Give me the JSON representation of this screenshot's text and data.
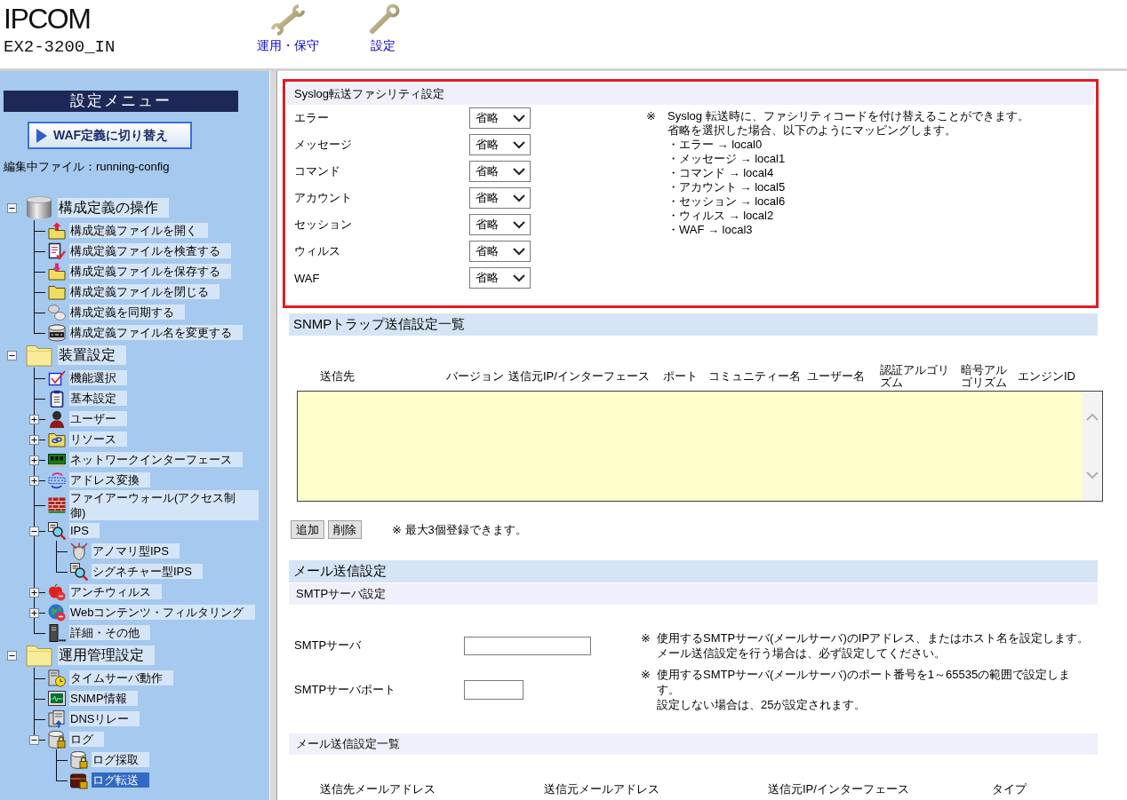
{
  "header": {
    "product": "IPCOM",
    "model": "EX2-3200_IN",
    "nav": [
      "運用・保守",
      "設定"
    ]
  },
  "sidebar": {
    "title": "設定メニュー",
    "switch_button": "WAF定義に切り替え",
    "editing_file": "編集中ファイル：running-config",
    "tree": [
      {
        "label": "構成定義の操作",
        "expanded": true,
        "selected": false,
        "children": [
          {
            "label": "構成定義ファイルを開く",
            "selected": false
          },
          {
            "label": "構成定義ファイルを検査する",
            "selected": false
          },
          {
            "label": "構成定義ファイルを保存する",
            "selected": false
          },
          {
            "label": "構成定義ファイルを閉じる",
            "selected": false
          },
          {
            "label": "構成定義を同期する",
            "selected": false
          },
          {
            "label": "構成定義ファイル名を変更する",
            "selected": false
          }
        ]
      },
      {
        "label": "装置設定",
        "expanded": true,
        "selected": false,
        "children": [
          {
            "label": "機能選択",
            "selected": false
          },
          {
            "label": "基本設定",
            "selected": false
          },
          {
            "label": "ユーザー",
            "expanded": false,
            "selected": false
          },
          {
            "label": "リソース",
            "expanded": false,
            "selected": false
          },
          {
            "label": "ネットワークインターフェース",
            "expanded": false,
            "selected": false
          },
          {
            "label": "アドレス変換",
            "expanded": false,
            "selected": false
          },
          {
            "label": "ファイアーウォール(アクセス制御)",
            "selected": false
          },
          {
            "label": "IPS",
            "expanded": true,
            "selected": false,
            "children": [
              {
                "label": "アノマリ型IPS",
                "selected": false
              },
              {
                "label": "シグネチャー型IPS",
                "selected": false
              }
            ]
          },
          {
            "label": "アンチウィルス",
            "expanded": false,
            "selected": false
          },
          {
            "label": "Webコンテンツ・フィルタリング",
            "expanded": false,
            "selected": false
          },
          {
            "label": "詳細・その他",
            "selected": false
          }
        ]
      },
      {
        "label": "運用管理設定",
        "expanded": true,
        "selected": false,
        "children": [
          {
            "label": "タイムサーバ動作",
            "selected": false
          },
          {
            "label": "SNMP情報",
            "selected": false
          },
          {
            "label": "DNSリレー",
            "selected": false
          },
          {
            "label": "ログ",
            "expanded": true,
            "selected": false,
            "children": [
              {
                "label": "ログ採取",
                "selected": false
              },
              {
                "label": "ログ転送",
                "selected": true
              }
            ]
          }
        ]
      }
    ]
  },
  "syslog": {
    "title": "Syslog転送ファシリティ設定",
    "highlighted": true,
    "rows": [
      {
        "label": "エラー",
        "value": "省略"
      },
      {
        "label": "メッセージ",
        "value": "省略"
      },
      {
        "label": "コマンド",
        "value": "省略"
      },
      {
        "label": "アカウント",
        "value": "省略"
      },
      {
        "label": "セッション",
        "value": "省略"
      },
      {
        "label": "ウィルス",
        "value": "省略"
      },
      {
        "label": "WAF",
        "value": "省略"
      }
    ],
    "note_mark": "※",
    "note": [
      "Syslog 転送時に、ファシリティコードを付け替えることができます。",
      "省略を選択した場合、以下のようにマッピングします。"
    ],
    "mappings": [
      "・エラー → local0",
      "・メッセージ → local1",
      "・コマンド → local4",
      "・アカウント → local5",
      "・セッション → local6",
      "・ウィルス → local2",
      "・WAF → local3"
    ]
  },
  "snmp": {
    "title": "SNMPトラップ送信設定一覧",
    "columns": [
      "送信先",
      "バージョン",
      "送信元IP/インターフェース",
      "ポート",
      "コミュニティー名",
      "ユーザー名",
      "認証アルゴリズム",
      "暗号アルゴリズム",
      "エンジンID"
    ],
    "buttons": [
      "追加",
      "削除"
    ],
    "note": "※ 最大3個登録できます。"
  },
  "mail": {
    "title": "メール送信設定",
    "smtp_title": "SMTPサーバ設定",
    "fields": [
      {
        "label": "SMTPサーバ",
        "kind": "text",
        "note_mark": "※",
        "note": [
          "使用するSMTPサーバ(メールサーバ)のIPアドレス、またはホスト名を設定します。",
          "メール送信設定を行う場合は、必ず設定してください。"
        ]
      },
      {
        "label": "SMTPサーバポート",
        "kind": "number",
        "note_mark": "※",
        "note": [
          "使用するSMTPサーバ(メールサーバ)のポート番号を1～65535の範囲で設定します。",
          "設定しない場合は、25が設定されます。"
        ]
      }
    ],
    "list_title": "メール送信設定一覧",
    "list_columns": [
      "送信先メールアドレス",
      "送信元メールアドレス",
      "送信元IP/インターフェース",
      "タイプ"
    ]
  }
}
